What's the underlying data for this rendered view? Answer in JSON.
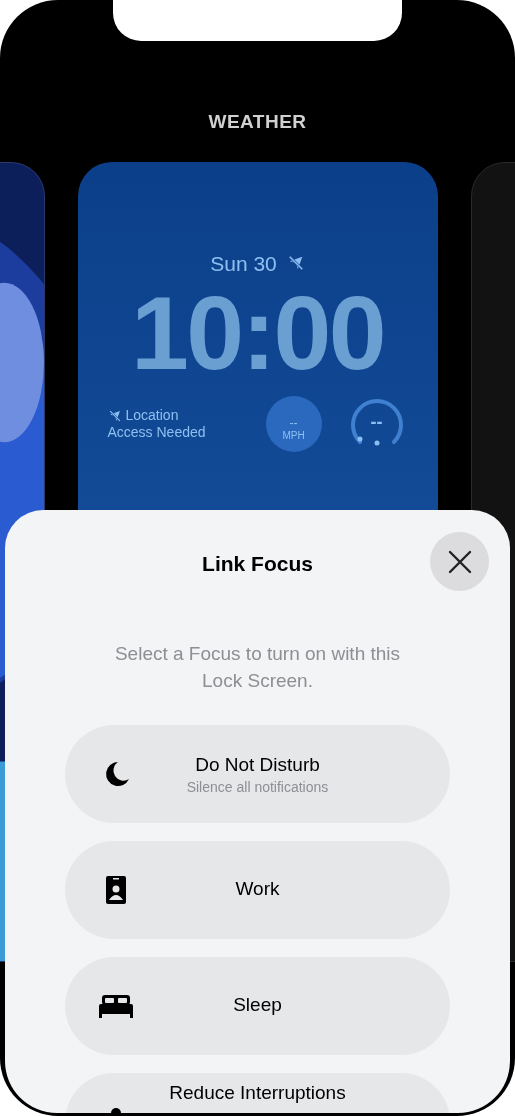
{
  "header": {
    "title": "WEATHER"
  },
  "lock_screen": {
    "date": "Sun 30",
    "time": "10:00",
    "location_text": [
      "Location",
      "Access Needed"
    ],
    "wind": {
      "value": "--",
      "unit": "MPH"
    },
    "uv": {
      "value": "--"
    }
  },
  "sheet": {
    "title": "Link Focus",
    "description": "Select a Focus to turn on with this Lock Screen.",
    "options": [
      {
        "kind": "moon",
        "label": "Do Not Disturb",
        "subtitle": "Silence all notifications"
      },
      {
        "kind": "badge",
        "label": "Work"
      },
      {
        "kind": "bed",
        "label": "Sleep"
      },
      {
        "kind": "person",
        "label": "Reduce Interruptions"
      }
    ]
  }
}
